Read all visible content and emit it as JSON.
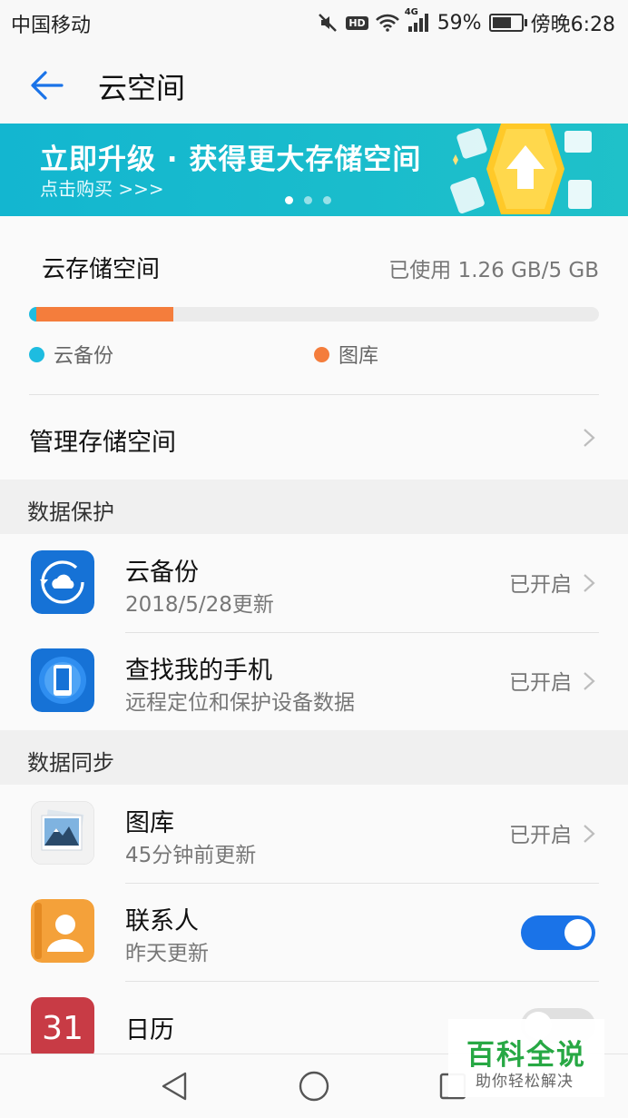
{
  "status_bar": {
    "carrier": "中国移动",
    "hd": "HD",
    "network": "4G",
    "battery": "59%",
    "time": "傍晚6:28"
  },
  "app_bar": {
    "title": "云空间",
    "back_icon": "arrow-left-icon",
    "accent_color": "#1a73e8"
  },
  "banner": {
    "headline": "立即升级 · 获得更大存储空间",
    "subtext": "点击购买 >>>",
    "page_count": 3,
    "active_page": 1
  },
  "storage": {
    "label": "云存储空间",
    "usage_text": "已使用 1.26 GB/5 GB",
    "used_gb": 1.26,
    "total_gb": 5,
    "breakdown": [
      {
        "name": "云备份",
        "fraction": 0.012,
        "color": "#1ebce0"
      },
      {
        "name": "图库",
        "fraction": 0.24,
        "color": "#f47d3c"
      }
    ],
    "manage_label": "管理存储空间"
  },
  "sections": {
    "protection": {
      "title": "数据保护",
      "items": [
        {
          "title": "云备份",
          "subtitle": "2018/5/28更新",
          "status": "已开启",
          "icon": "cloud-backup-icon"
        },
        {
          "title": "查找我的手机",
          "subtitle": "远程定位和保护设备数据",
          "status": "已开启",
          "icon": "find-phone-icon"
        }
      ]
    },
    "sync": {
      "title": "数据同步",
      "items": [
        {
          "title": "图库",
          "subtitle": "45分钟前更新",
          "status": "已开启",
          "icon": "gallery-icon"
        },
        {
          "title": "联系人",
          "subtitle": "昨天更新",
          "toggle": true,
          "icon": "contacts-icon"
        },
        {
          "title": "日历",
          "calendar_day": "31",
          "toggle": false,
          "icon": "calendar-icon"
        }
      ]
    }
  },
  "watermark": {
    "title": "百科全说",
    "subtitle": "助你轻松解决"
  },
  "nav": {
    "icons": [
      "back-triangle-icon",
      "home-circle-icon",
      "recents-square-icon"
    ]
  }
}
